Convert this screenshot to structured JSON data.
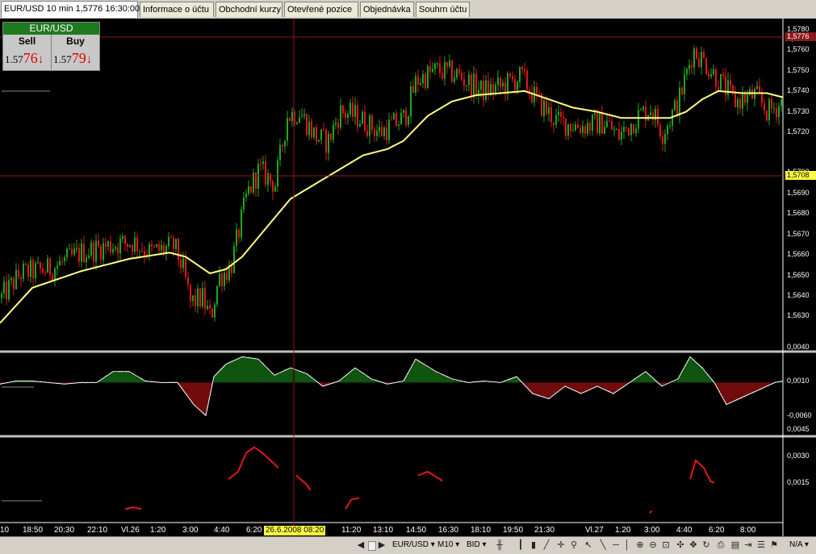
{
  "tabs": [
    {
      "label": "EUR/USD 10 min 1,5776 16:30:00",
      "active": true
    },
    {
      "label": "Informace o účtu",
      "active": false
    },
    {
      "label": "Obchodní kurzy",
      "active": false
    },
    {
      "label": "Otevřené pozice",
      "active": false
    },
    {
      "label": "Objednávka",
      "active": false
    },
    {
      "label": "Souhrn účtu",
      "active": false
    }
  ],
  "quote": {
    "symbol": "EUR/USD",
    "sell_label": "Sell",
    "buy_label": "Buy",
    "sell_prefix": "1.57",
    "sell_big": "76",
    "buy_prefix": "1.57",
    "buy_big": "79",
    "arrow": "↓"
  },
  "price_axis": {
    "labels": [
      "1,5780",
      "1,5770",
      "1,5760",
      "1,5750",
      "1,5740",
      "1,5730",
      "1,5720",
      "1,5700",
      "1,5690",
      "1,5680",
      "1,5670",
      "1,5660",
      "1,5650",
      "1,5640",
      "1,5630"
    ],
    "current_price": "1,5776",
    "cursor_price": "1,5708"
  },
  "osc_axis": {
    "labels": [
      "0,0040",
      "0,0010",
      "-0,0060"
    ]
  },
  "ind_axis": {
    "labels": [
      "0,0045",
      "0,0030",
      "0,0015"
    ]
  },
  "time_axis": {
    "labels": [
      "10",
      "18:50",
      "20:30",
      "22:10",
      "Vl.26",
      "1:20",
      "3:00",
      "4:40",
      "6:20",
      "11:20",
      "13:10",
      "14:50",
      "16:30",
      "18:10",
      "19:50",
      "21:30",
      "Vl.27",
      "1:20",
      "3:00",
      "4:40",
      "6:20",
      "8:00"
    ],
    "cursor_label": "26.6.2008 08:20"
  },
  "toolbar": {
    "symbol": "EUR/USD",
    "timeframe": "M10",
    "price_type": "BID",
    "na_label": "N/A"
  },
  "colors": {
    "background": "#000000",
    "bull": "#1ea81e",
    "bear": "#e01818",
    "ma": "#ffff80",
    "indicator": "#e01818",
    "grid_line": "#8b1a1a",
    "panel_sep": "#c0c0c0"
  },
  "chart_data": {
    "type": "candlestick",
    "ylim": [
      1.5625,
      1.5785
    ],
    "price_path": [
      [
        0,
        1.565
      ],
      [
        25,
        1.5662
      ],
      [
        60,
        1.5664
      ],
      [
        100,
        1.5672
      ],
      [
        140,
        1.5676
      ],
      [
        165,
        1.5677
      ],
      [
        185,
        1.5672
      ],
      [
        215,
        1.5675
      ],
      [
        225,
        1.5665
      ],
      [
        235,
        1.5648
      ],
      [
        250,
        1.565
      ],
      [
        260,
        1.564
      ],
      [
        270,
        1.566
      ],
      [
        285,
        1.5665
      ],
      [
        305,
        1.57
      ],
      [
        320,
        1.5712
      ],
      [
        340,
        1.5705
      ],
      [
        355,
        1.5738
      ],
      [
        370,
        1.574
      ],
      [
        390,
        1.5728
      ],
      [
        405,
        1.5725
      ],
      [
        420,
        1.574
      ],
      [
        440,
        1.5738
      ],
      [
        470,
        1.573
      ],
      [
        500,
        1.5737
      ],
      [
        515,
        1.5755
      ],
      [
        540,
        1.576
      ],
      [
        565,
        1.5758
      ],
      [
        595,
        1.575
      ],
      [
        620,
        1.5752
      ],
      [
        645,
        1.5757
      ],
      [
        665,
        1.5745
      ],
      [
        690,
        1.5735
      ],
      [
        720,
        1.5733
      ],
      [
        750,
        1.5735
      ],
      [
        765,
        1.5728
      ],
      [
        790,
        1.5738
      ],
      [
        805,
        1.5742
      ],
      [
        820,
        1.573
      ],
      [
        840,
        1.5745
      ],
      [
        858,
        1.577
      ],
      [
        870,
        1.5765
      ],
      [
        890,
        1.5755
      ],
      [
        910,
        1.5745
      ],
      [
        935,
        1.5748
      ],
      [
        950,
        1.574
      ],
      [
        970,
        1.5745
      ]
    ],
    "ma_path": [
      [
        0,
        1.5638
      ],
      [
        40,
        1.5655
      ],
      [
        100,
        1.5663
      ],
      [
        160,
        1.5669
      ],
      [
        210,
        1.5672
      ],
      [
        230,
        1.567
      ],
      [
        260,
        1.5662
      ],
      [
        280,
        1.5664
      ],
      [
        300,
        1.567
      ],
      [
        330,
        1.5684
      ],
      [
        360,
        1.5698
      ],
      [
        390,
        1.5705
      ],
      [
        420,
        1.5712
      ],
      [
        450,
        1.5719
      ],
      [
        480,
        1.5722
      ],
      [
        500,
        1.5726
      ],
      [
        530,
        1.5738
      ],
      [
        560,
        1.5745
      ],
      [
        590,
        1.5748
      ],
      [
        620,
        1.5749
      ],
      [
        650,
        1.575
      ],
      [
        680,
        1.5746
      ],
      [
        710,
        1.5742
      ],
      [
        740,
        1.574
      ],
      [
        770,
        1.5737
      ],
      [
        800,
        1.5737
      ],
      [
        830,
        1.5737
      ],
      [
        850,
        1.574
      ],
      [
        870,
        1.5746
      ],
      [
        890,
        1.575
      ],
      [
        920,
        1.5749
      ],
      [
        950,
        1.5749
      ],
      [
        970,
        1.5747
      ]
    ],
    "oscillator_ylim": [
      -0.006,
      0.005
    ],
    "oscillator_path": [
      [
        0,
        0.0008
      ],
      [
        20,
        0.0012
      ],
      [
        40,
        0.0012
      ],
      [
        60,
        0.001
      ],
      [
        80,
        0.0008
      ],
      [
        100,
        0.001
      ],
      [
        120,
        0.001
      ],
      [
        140,
        0.0025
      ],
      [
        160,
        0.0025
      ],
      [
        180,
        0.0012
      ],
      [
        200,
        0.001
      ],
      [
        220,
        0.001
      ],
      [
        240,
        -0.002
      ],
      [
        255,
        -0.0035
      ],
      [
        265,
        0.0018
      ],
      [
        280,
        0.0035
      ],
      [
        300,
        0.0045
      ],
      [
        320,
        0.0042
      ],
      [
        340,
        0.002
      ],
      [
        360,
        0.003
      ],
      [
        380,
        0.0022
      ],
      [
        400,
        0.0005
      ],
      [
        420,
        0.0012
      ],
      [
        440,
        0.003
      ],
      [
        460,
        0.0015
      ],
      [
        480,
        0.0008
      ],
      [
        500,
        0.0012
      ],
      [
        515,
        0.0042
      ],
      [
        540,
        0.0025
      ],
      [
        560,
        0.0015
      ],
      [
        580,
        0.001
      ],
      [
        600,
        0.0012
      ],
      [
        620,
        0.001
      ],
      [
        640,
        0.0018
      ],
      [
        660,
        -0.0005
      ],
      [
        680,
        -0.0012
      ],
      [
        700,
        0.0005
      ],
      [
        720,
        -0.0005
      ],
      [
        740,
        0.0005
      ],
      [
        760,
        -0.0005
      ],
      [
        780,
        0.001
      ],
      [
        800,
        0.0025
      ],
      [
        820,
        0.0005
      ],
      [
        840,
        0.0015
      ],
      [
        855,
        0.0045
      ],
      [
        870,
        0.003
      ],
      [
        885,
        0.001
      ],
      [
        900,
        -0.002
      ],
      [
        920,
        -0.001
      ],
      [
        940,
        0.0
      ],
      [
        960,
        0.001
      ],
      [
        970,
        0.0012
      ]
    ],
    "indicator_ylim": [
      0.0005,
      0.0048
    ],
    "indicator_segments": [
      [
        [
          155,
          0.001
        ],
        [
          165,
          0.0011
        ],
        [
          175,
          0.001
        ]
      ],
      [
        [
          283,
          0.0026
        ],
        [
          295,
          0.003
        ],
        [
          305,
          0.004
        ],
        [
          315,
          0.0043
        ],
        [
          325,
          0.004
        ],
        [
          335,
          0.0036
        ],
        [
          345,
          0.0032
        ]
      ],
      [
        [
          367,
          0.0028
        ],
        [
          380,
          0.0023
        ],
        [
          385,
          0.002
        ]
      ],
      [
        [
          428,
          0.001
        ],
        [
          435,
          0.0015
        ],
        [
          445,
          0.0016
        ]
      ],
      [
        [
          518,
          0.0028
        ],
        [
          530,
          0.003
        ],
        [
          545,
          0.0026
        ],
        [
          548,
          0.0025
        ]
      ],
      [
        [
          805,
          0.0008
        ],
        [
          808,
          0.0009
        ]
      ],
      [
        [
          855,
          0.0026
        ],
        [
          862,
          0.0036
        ],
        [
          872,
          0.0032
        ],
        [
          880,
          0.0025
        ],
        [
          885,
          0.0024
        ]
      ]
    ]
  }
}
